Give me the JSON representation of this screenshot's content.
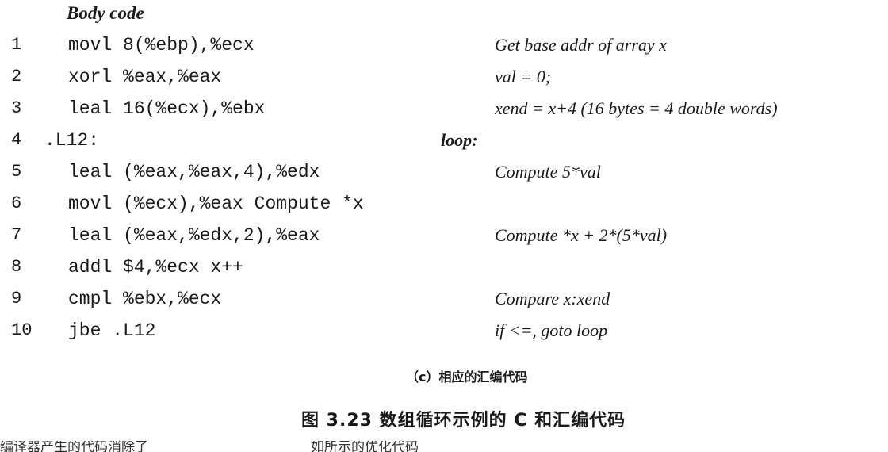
{
  "header": {
    "title": "Body code"
  },
  "lines": [
    {
      "num": "1",
      "code": "movl 8(%ebp),%ecx",
      "comment": "Get base addr of array x"
    },
    {
      "num": "2",
      "code": "xorl %eax,%eax",
      "comment": "val = 0;"
    },
    {
      "num": "3",
      "code": "leal 16(%ecx),%ebx",
      "comment": "xend = x+4 (16 bytes = 4 double words)"
    },
    {
      "num": "4",
      "code": ".L12:",
      "comment": "loop:"
    },
    {
      "num": "5",
      "code": "leal (%eax,%eax,4),%edx",
      "comment": "Compute 5*val"
    },
    {
      "num": "6",
      "code": "movl (%ecx),%eax Compute *x",
      "comment": ""
    },
    {
      "num": "7",
      "code": "leal (%eax,%edx,2),%eax",
      "comment": "Compute *x + 2*(5*val)"
    },
    {
      "num": "8",
      "code": "addl $4,%ecx x++",
      "comment": ""
    },
    {
      "num": "9",
      "code": "cmpl %ebx,%ecx",
      "comment": "Compare x:xend"
    },
    {
      "num": "10",
      "code": "jbe .L12",
      "comment": "if <=, goto loop"
    }
  ],
  "sub_caption": "（c）相应的汇编代码",
  "figure_caption": "图 3.23   数组循环示例的 C 和汇编代码",
  "cutoff": {
    "left_text": "编译器产生的代码消除了",
    "right_text": "如所示的优化代码"
  }
}
